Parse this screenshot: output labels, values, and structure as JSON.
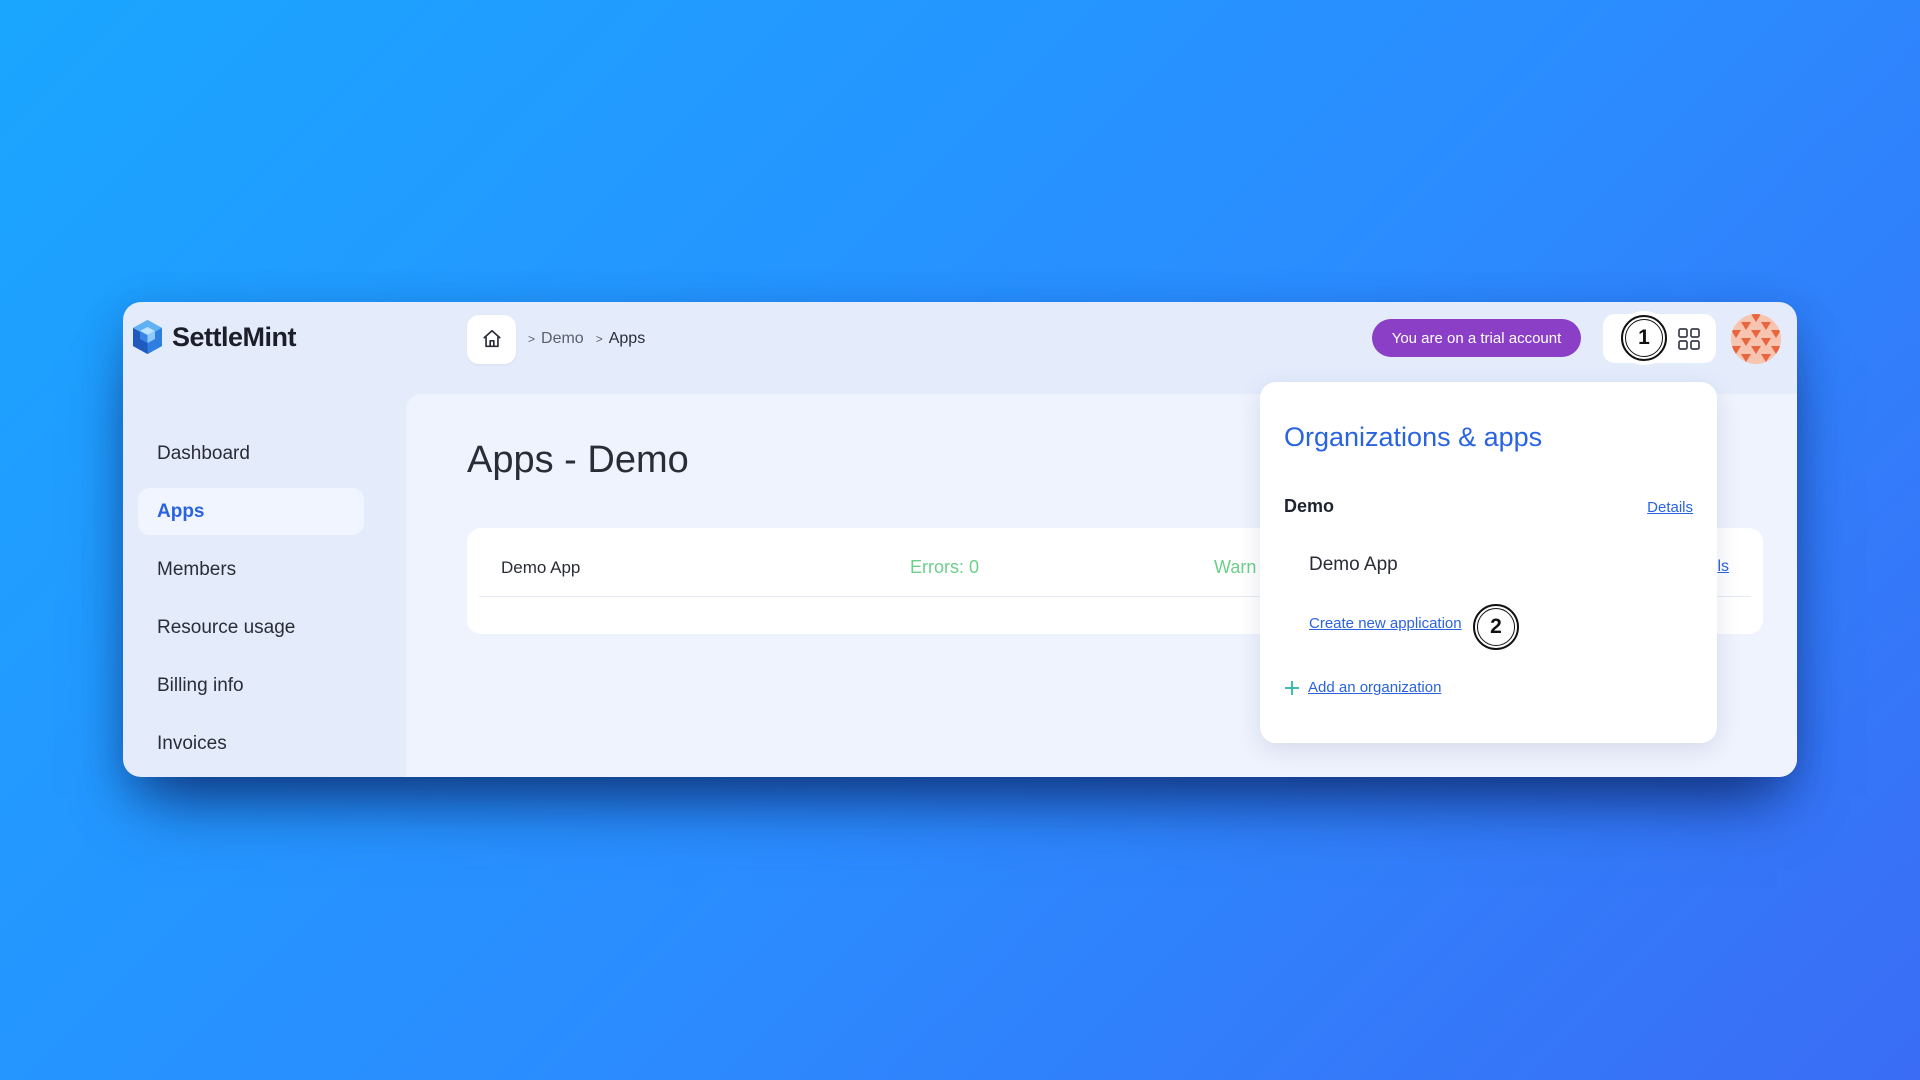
{
  "brand": {
    "name": "SettleMint"
  },
  "breadcrumb": {
    "home_icon": "home-icon",
    "items": [
      "Demo",
      "Apps"
    ],
    "separator": ">"
  },
  "header": {
    "trial_badge": "You are on a trial account",
    "grid_icon": "grid-icon",
    "avatar_icon": "avatar"
  },
  "sidebar": {
    "items": [
      {
        "label": "Dashboard",
        "active": false
      },
      {
        "label": "Apps",
        "active": true
      },
      {
        "label": "Members",
        "active": false
      },
      {
        "label": "Resource usage",
        "active": false
      },
      {
        "label": "Billing info",
        "active": false
      },
      {
        "label": "Invoices",
        "active": false
      }
    ]
  },
  "main": {
    "title": "Apps - Demo",
    "create_button_visible": "pp",
    "apps": [
      {
        "name": "Demo App",
        "errors": "Errors: 0",
        "warnings": "Warn",
        "details": "ls"
      }
    ]
  },
  "dropdown": {
    "title": "Organizations & apps",
    "org_name": "Demo",
    "org_details": "Details",
    "app_name": "Demo App",
    "create_app": "Create new application",
    "add_org": "Add an organization"
  },
  "markers": [
    "1",
    "2"
  ],
  "colors": {
    "accent": "#2a63e0",
    "trial": "#8b3fc6",
    "success": "#6cd08a",
    "primary_button": "#3567e5"
  }
}
